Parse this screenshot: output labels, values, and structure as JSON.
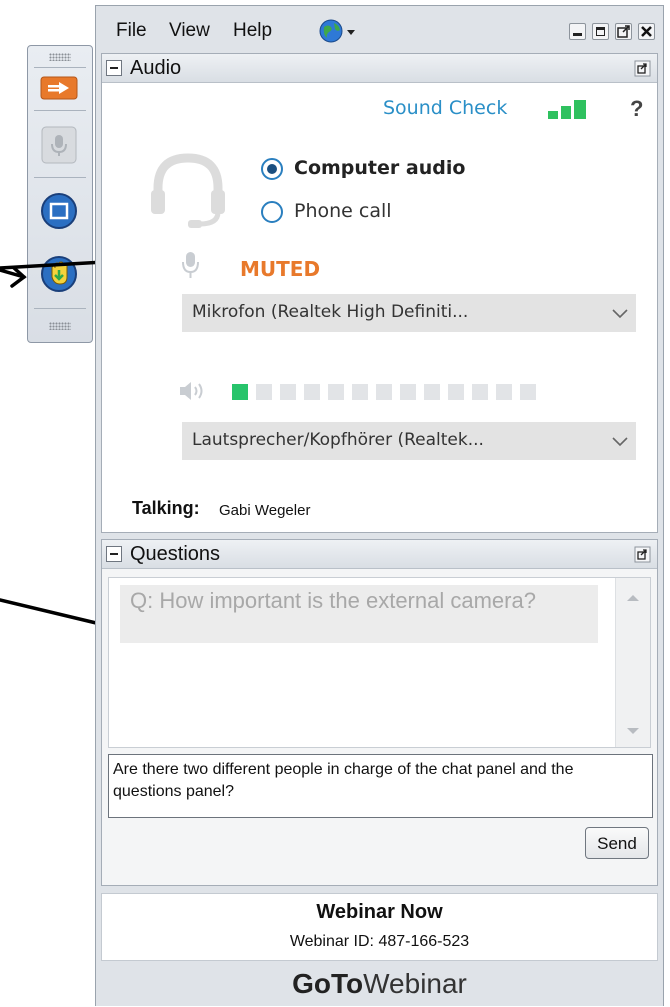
{
  "menu": {
    "file": "File",
    "view": "View",
    "help": "Help"
  },
  "audio": {
    "title": "Audio",
    "sound_check": "Sound Check",
    "help_mark": "?",
    "option_computer": "Computer audio",
    "option_phone": "Phone call",
    "selected_option": "Computer audio",
    "mic_status": "MUTED",
    "microphone_device": "Mikrofon (Realtek High Definiti...",
    "speaker_level": 0.08,
    "speaker_device": "Lautsprecher/Kopfhörer (Realtek...",
    "talking_label": "Talking:",
    "talking_name": "Gabi Wegeler",
    "colors": {
      "muted": "#e8792b",
      "accent": "#2a7fbf",
      "level": "#27c46b"
    }
  },
  "questions": {
    "title": "Questions",
    "question": "Q: How important is the external camera?",
    "draft": "Are there two different people in charge of the chat panel and the questions panel?",
    "send": "Send"
  },
  "webinar": {
    "name": "Webinar Now",
    "id_label": "Webinar ID: 487-166-523",
    "brand_bold": "GoTo",
    "brand_light": "Webinar"
  }
}
